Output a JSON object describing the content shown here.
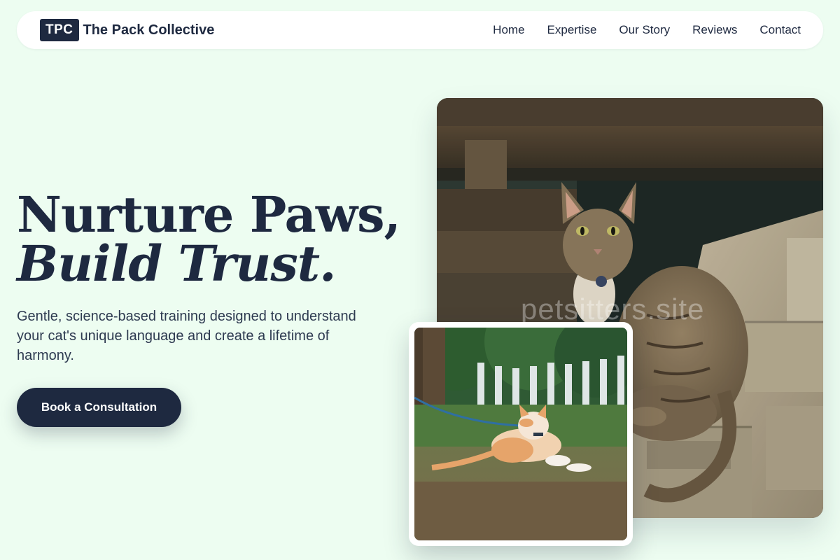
{
  "brand": {
    "badge": "TPC",
    "name": "The Pack Collective"
  },
  "nav": {
    "items": [
      {
        "label": "Home"
      },
      {
        "label": "Expertise"
      },
      {
        "label": "Our Story"
      },
      {
        "label": "Reviews"
      },
      {
        "label": "Contact"
      }
    ]
  },
  "hero": {
    "headline_line1": "Nurture Paws,",
    "headline_line2": "Build Trust.",
    "subtitle": "Gentle, science-based training designed to understand your cat's unique language and create a lifetime of harmony.",
    "cta_label": "Book a Consultation"
  },
  "photos": {
    "main_watermark": "petsitters.site",
    "main_icon": "tabby-cat-on-cinder-blocks-photo",
    "inset_icon": "orange-kitten-on-leash-photo"
  },
  "colors": {
    "background": "#edfdf1",
    "primary": "#1e2940",
    "surface": "#ffffff"
  }
}
